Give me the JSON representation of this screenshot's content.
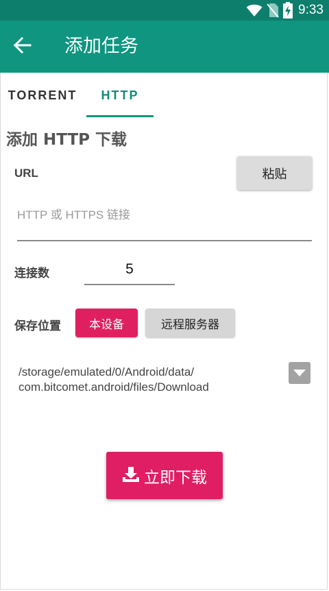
{
  "status_bar": {
    "time": "9:33",
    "icons": [
      "wifi-icon",
      "no-sim-icon",
      "battery-charging-icon"
    ]
  },
  "app_bar": {
    "title": "添加任务",
    "back_icon": "arrow-left-icon"
  },
  "tabs": [
    {
      "label": "TORRENT",
      "selected": false
    },
    {
      "label": "HTTP",
      "selected": true
    }
  ],
  "form": {
    "section_title": "添加 HTTP 下载",
    "url_label": "URL",
    "paste_label": "粘贴",
    "url_value": "",
    "url_placeholder": "HTTP 或 HTTPS 链接",
    "connections_label": "连接数",
    "connections_value": "5",
    "save_location_label": "保存位置",
    "save_options": [
      {
        "label": "本设备",
        "selected": true
      },
      {
        "label": "远程服务器",
        "selected": false
      }
    ],
    "path_lines": [
      "/storage/emulated/0/Android/data/",
      "com.bitcomet.android/files/Download"
    ],
    "download_label": "立即下载",
    "download_icon": "download-icon"
  },
  "colors": {
    "status_bar": "#0e7e6c",
    "app_bar": "#0f9580",
    "accent": "#df1e63",
    "tab_selected": "#0f8c78"
  }
}
